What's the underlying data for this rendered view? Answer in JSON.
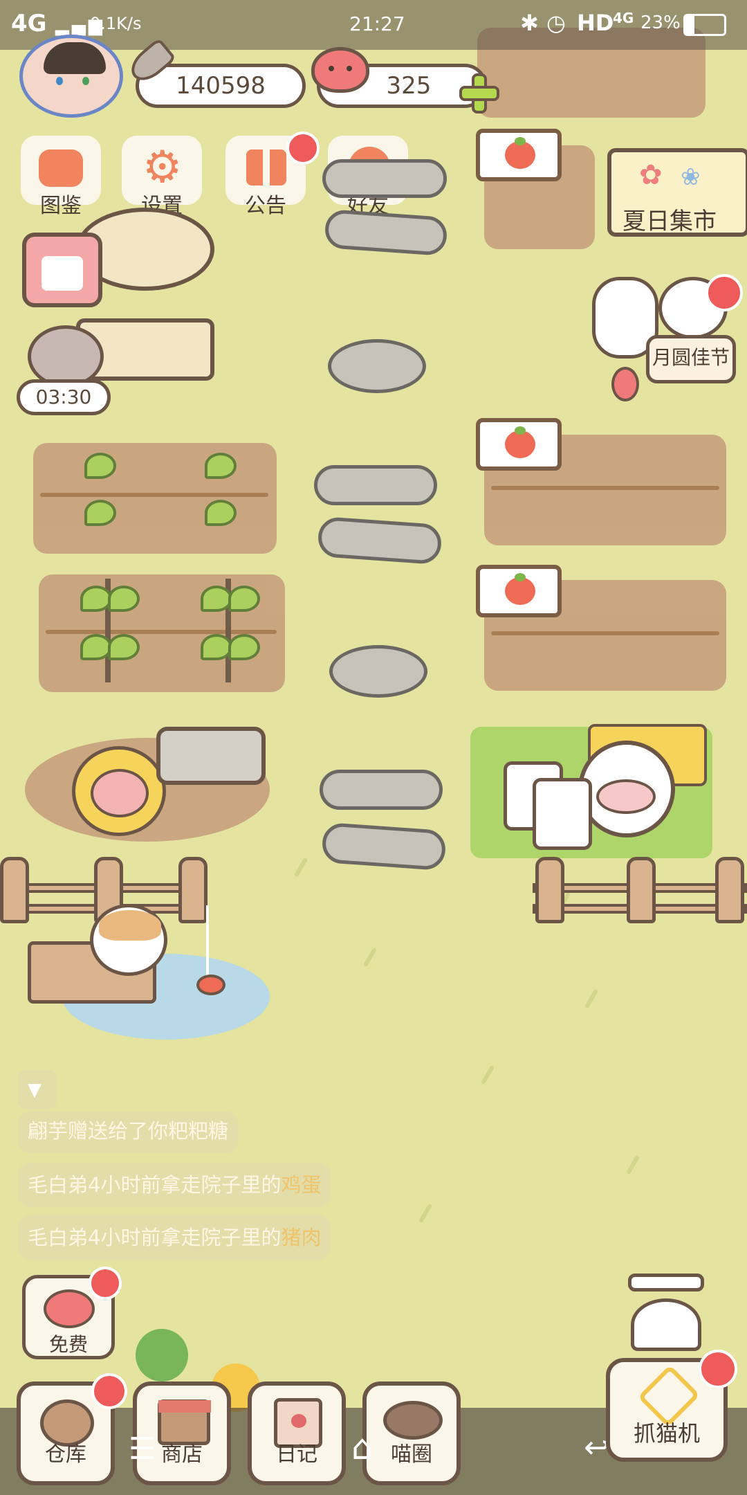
{
  "status_bar": {
    "network": "4G",
    "speed": "0.1K/s",
    "time": "21:27",
    "hd": "HD",
    "net2": "4G",
    "battery": "23%"
  },
  "header": {
    "fish_currency": "140598",
    "heart_currency": "325"
  },
  "menu": {
    "collection": "图鉴",
    "settings": "设置",
    "notice": "公告",
    "friends": "好友"
  },
  "timer": "03:30",
  "events": {
    "summer_market": "夏日集市",
    "moon_festival": "月圆佳节"
  },
  "messages": [
    {
      "prefix": "",
      "name": "翩芋",
      "middle": "赠送给了你粑粑糖",
      "item": ""
    },
    {
      "prefix": "",
      "name": "毛白弟",
      "middle": "4小时前拿走院子里的",
      "item": "鸡蛋"
    },
    {
      "prefix": "",
      "name": "毛白弟",
      "middle": "4小时前拿走院子里的",
      "item": "猪肉"
    }
  ],
  "free_label": "免费",
  "bottom_nav": {
    "warehouse": "仓库",
    "shop": "商店",
    "diary": "日记",
    "circle": "喵圈",
    "claw_machine": "抓猫机"
  },
  "colors": {
    "background": "#e4e3a0",
    "badge": "#ef5a5a",
    "soil": "#c9a37f",
    "outline": "#6b5546"
  }
}
